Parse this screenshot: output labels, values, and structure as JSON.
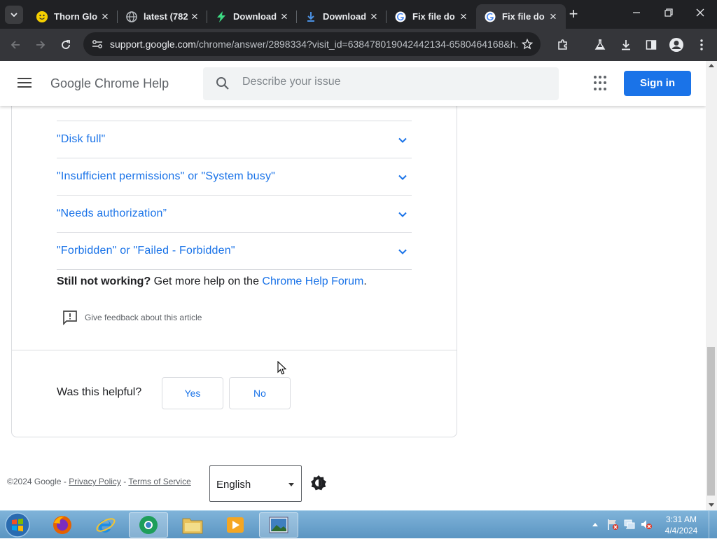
{
  "browser": {
    "tabs": [
      {
        "title": "Thorn Glo",
        "favicon": "smiley-icon"
      },
      {
        "title": "latest (782",
        "favicon": "globe-icon"
      },
      {
        "title": "Download",
        "favicon": "bolt-icon"
      },
      {
        "title": "Download",
        "favicon": "download-icon"
      },
      {
        "title": "Fix file do",
        "favicon": "google-icon"
      },
      {
        "title": "Fix file do",
        "favicon": "google-icon",
        "active": true
      }
    ],
    "url_host": "support.google.com",
    "url_path": "/chrome/answer/2898334?visit_id=638478019042442134-6580464168&h..."
  },
  "header": {
    "site_title": "Google Chrome Help",
    "search_placeholder": "Describe your issue",
    "signin_label": "Sign in"
  },
  "article": {
    "accordion": [
      {
        "label": "\"Disk full\""
      },
      {
        "label": "\"Insufficient permissions\" or \"System busy\""
      },
      {
        "label": "“Needs authorization”"
      },
      {
        "label": "\"Forbidden\" or \"Failed - Forbidden\""
      }
    ],
    "still_bold": "Still not working?",
    "still_text": " Get more help on the ",
    "still_link": "Chrome Help Forum",
    "still_end": ".",
    "feedback": "Give feedback about this article",
    "helpful_q": "Was this helpful?",
    "yes": "Yes",
    "no": "No"
  },
  "footer": {
    "copyright": "©2024 Google",
    "sep": " - ",
    "privacy": "Privacy Policy",
    "terms": "Terms of Service",
    "language": "English"
  },
  "taskbar": {
    "time": "3:31 AM",
    "date": "4/4/2024"
  },
  "colors": {
    "link": "#1a73e8",
    "tabstrip": "#202124",
    "toolbar": "#35363a"
  }
}
